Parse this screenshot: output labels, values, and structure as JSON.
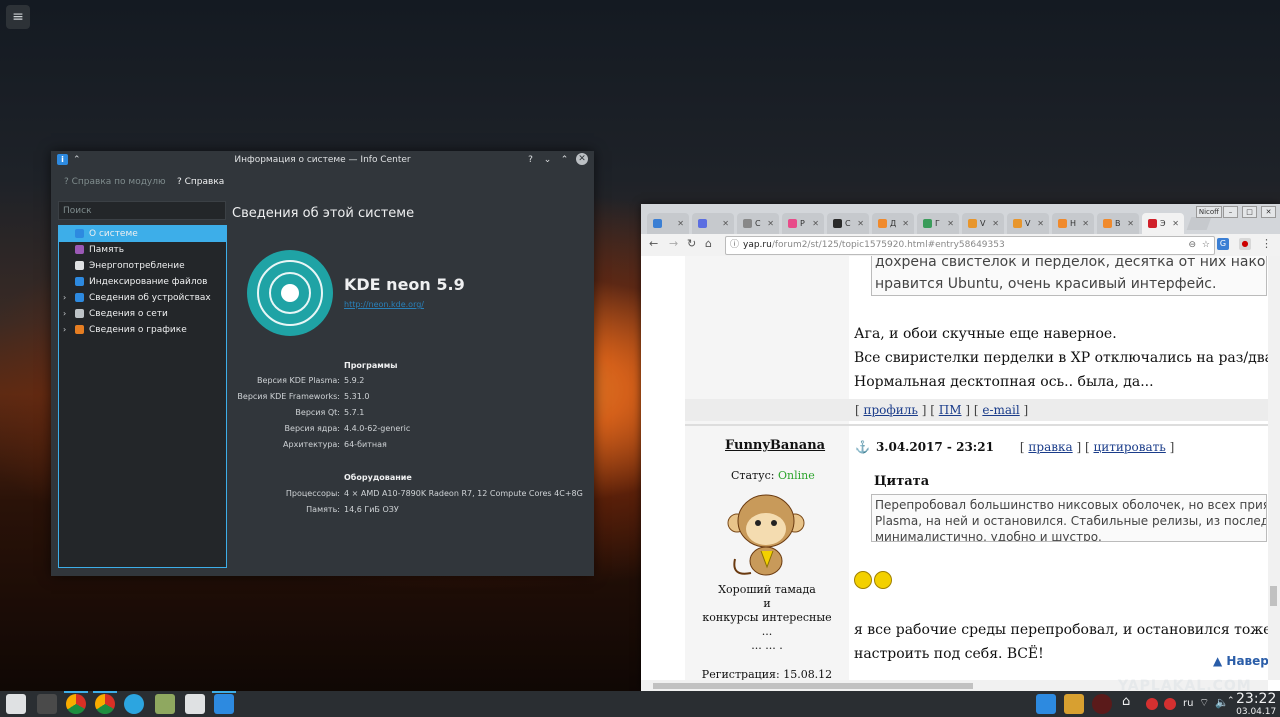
{
  "desktop": {
    "menu_icon": "hamburger-icon"
  },
  "infocenter": {
    "title": "Информация о системе — Info Center",
    "toolbar": {
      "module_help": "Справка по модулю",
      "help": "Справка"
    },
    "search_placeholder": "Поиск",
    "sidebar": [
      {
        "label": "О системе",
        "icon": "info-icon",
        "color": "#2d8ae0",
        "selected": true,
        "expandable": false
      },
      {
        "label": "Память",
        "icon": "memory-icon",
        "color": "#9b59b6",
        "selected": false,
        "expandable": false
      },
      {
        "label": "Энергопотребление",
        "icon": "battery-icon",
        "color": "#dfe1e3",
        "selected": false,
        "expandable": false
      },
      {
        "label": "Индексирование файлов",
        "icon": "baloo-icon",
        "color": "#2d8ae0",
        "selected": false,
        "expandable": false
      },
      {
        "label": "Сведения об устройствах",
        "icon": "device-icon",
        "color": "#2d8ae0",
        "selected": false,
        "expandable": true
      },
      {
        "label": "Сведения о сети",
        "icon": "network-icon",
        "color": "#bdc3c7",
        "selected": false,
        "expandable": true
      },
      {
        "label": "Сведения о графике",
        "icon": "graphics-icon",
        "color": "#e67e22",
        "selected": false,
        "expandable": true
      }
    ],
    "heading": "Сведения об этой системе",
    "distro": "KDE neon 5.9",
    "url": "http://neon.kde.org/",
    "software_title": "Программы",
    "software": [
      {
        "key": "Версия KDE Plasma:",
        "value": "5.9.2"
      },
      {
        "key": "Версия KDE Frameworks:",
        "value": "5.31.0"
      },
      {
        "key": "Версия Qt:",
        "value": "5.7.1"
      },
      {
        "key": "Версия ядра:",
        "value": "4.4.0-62-generic"
      },
      {
        "key": "Архитектура:",
        "value": "64-битная"
      }
    ],
    "hardware_title": "Оборудование",
    "hardware": [
      {
        "key": "Процессоры:",
        "value": "4 × AMD A10-7890K Radeon R7, 12 Compute Cores 4C+8G"
      },
      {
        "key": "Память:",
        "value": "14,6 ГиБ ОЗУ"
      }
    ]
  },
  "browser": {
    "user": "Nicoff",
    "tabs": [
      {
        "label": "",
        "color": "#3b7fd4",
        "active": false
      },
      {
        "label": "",
        "color": "#5b6ee1",
        "active": false
      },
      {
        "label": "С",
        "color": "#888888",
        "active": false
      },
      {
        "label": "Р",
        "color": "#e84c8a",
        "active": false
      },
      {
        "label": "С",
        "color": "#2a2a2a",
        "active": false
      },
      {
        "label": "Д",
        "color": "#f08a2c",
        "active": false
      },
      {
        "label": "Г",
        "color": "#3a9c5a",
        "active": false
      },
      {
        "label": "V",
        "color": "#e8962c",
        "active": false
      },
      {
        "label": "V",
        "color": "#e8962c",
        "active": false
      },
      {
        "label": "Н",
        "color": "#f08a2c",
        "active": false
      },
      {
        "label": "В",
        "color": "#f08a2c",
        "active": false
      },
      {
        "label": "Э",
        "color": "#d0202a",
        "active": true
      }
    ],
    "url_host": "yap.ru",
    "url_path": "/forum2/st/125/topic1575920.html#entry58649353",
    "post1": {
      "quote": "дохрена свистелок и перделок, десятка от них наконец-то от\nнравится Ubuntu, очень красивый интерфейс.",
      "lines": [
        "Ага, и обои скучные еще наверное.",
        "Все свиристелки перделки в XP отключались на раз/два.",
        "Нормальная десктопная ось.. была, да..."
      ],
      "links": [
        "профиль",
        "ПМ",
        "e-mail"
      ]
    },
    "post2": {
      "username": "FunnyBanana",
      "date": "3.04.2017 - 23:21",
      "links": [
        "правка",
        "цитировать"
      ],
      "status_label": "Статус:",
      "status_value": "Online",
      "sig": [
        "Хороший тамада",
        "и",
        "конкурсы интересные",
        "...",
        "... ... ."
      ],
      "registration": "Регистрация: 15.08.12",
      "quote_head": "Цитата",
      "quote": "Перепробовал большинство никсовых оболочек, но всех приятнее\nPlasma, на ней и остановился. Стабильные релизы, из последних ве\nминималистично, удобно и шустро.",
      "lines": [
        "я все рабочие среды перепробовал, и остановился тоже на KDE, е",
        "настроить под себя. ВСЁ!"
      ],
      "nav": "Навер"
    }
  },
  "watermark": "YAPLAKAL.COM",
  "taskbar": {
    "apps": [
      {
        "icon": "kde-launcher-icon",
        "color": "#dfe1e3"
      },
      {
        "icon": "sublime-icon",
        "color": "#4a4a4a"
      },
      {
        "icon": "chrome-icon",
        "color": "#e0a020"
      },
      {
        "icon": "chrome-icon",
        "color": "#e0a020"
      },
      {
        "icon": "telegram-icon",
        "color": "#2ca5e0"
      },
      {
        "icon": "file-manager-icon",
        "color": "#8fa860"
      },
      {
        "icon": "notes-icon",
        "color": "#dfe1e3"
      },
      {
        "icon": "info-center-icon",
        "color": "#2d8ae0"
      }
    ],
    "lang": "ru",
    "time": "23:22",
    "date": "03.04.17"
  }
}
